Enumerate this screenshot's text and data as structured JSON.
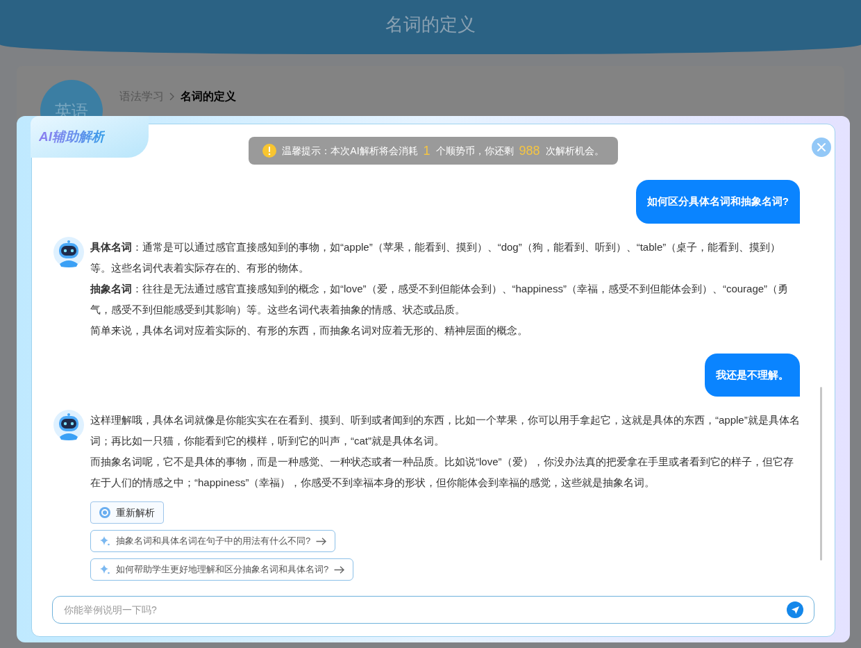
{
  "page": {
    "title": "名词的定义",
    "badge": "英语",
    "breadcrumb": [
      {
        "label": "语法学习",
        "selected": false
      },
      {
        "label": "名词的定义",
        "selected": true
      }
    ]
  },
  "dialog": {
    "title": "AI辅助解析",
    "notice": {
      "prefix": "温馨提示：本次AI解析将会消耗",
      "cost": "1",
      "middle": "个顺势币，你还剩",
      "remaining": "988",
      "suffix": "次解析机会。"
    },
    "messages": [
      {
        "kind": "user",
        "text": "如何区分具体名词和抽象名词?"
      },
      {
        "kind": "assistant",
        "paragraphs": [
          "**具体名词**：通常是可以通过感官直接感知到的事物，如“apple”（苹果，能看到、摸到）、“dog”（狗，能看到、听到）、“table”（桌子，能看到、摸到）等。这些名词代表着实际存在的、有形的物体。",
          "**抽象名词**：往往是无法通过感官直接感知到的概念，如“love”（爱，感受不到但能体会到）、“happiness”（幸福，感受不到但能体会到）、“courage”（勇气，感受不到但能感受到其影响）等。这些名词代表着抽象的情感、状态或品质。",
          "简单来说，具体名词对应着实际的、有形的东西，而抽象名词对应着无形的、精神层面的概念。"
        ]
      },
      {
        "kind": "user",
        "text": "我还是不理解。"
      },
      {
        "kind": "assistant",
        "paragraphs": [
          "这样理解哦，具体名词就像是你能实实在在看到、摸到、听到或者闻到的东西，比如一个苹果，你可以用手拿起它，这就是具体的东西，“apple”就是具体名词；再比如一只猫，你能看到它的模样，听到它的叫声，“cat”就是具体名词。",
          "而抽象名词呢，它不是具体的事物，而是一种感觉、一种状态或者一种品质。比如说“love”（爱），你没办法真的把爱拿在手里或者看到它的样子，但它存在于人们的情感之中；“happiness”（幸福），你感受不到幸福本身的形状，但你能体会到幸福的感觉，这些就是抽象名词。"
        ]
      }
    ],
    "regenerate": "重新解析",
    "suggestions": [
      "抽象名词和具体名词在句子中的用法有什么不同?",
      "如何帮助学生更好地理解和区分抽象名词和具体名词?"
    ],
    "input": {
      "placeholder": "你能举例说明一下吗?"
    }
  }
}
